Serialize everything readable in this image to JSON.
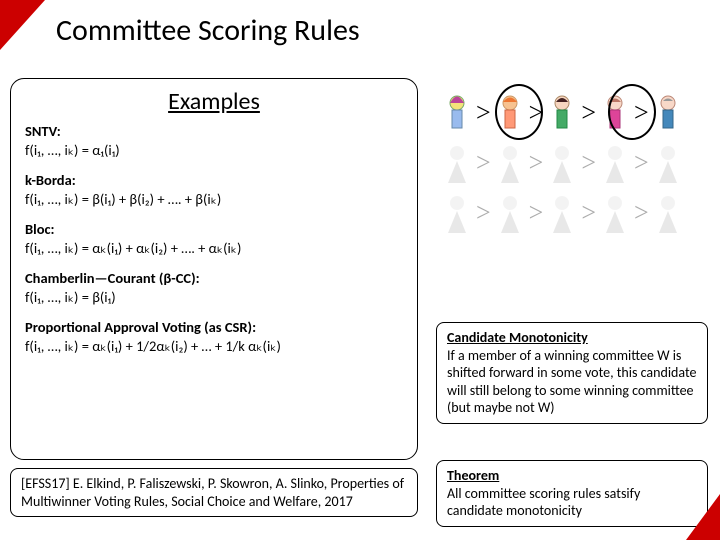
{
  "title": "Committee Scoring Rules",
  "examples": {
    "heading": "Examples",
    "sntv_label": "SNTV:",
    "sntv_formula": "f(i₁, …, iₖ) = α₁(i₁)",
    "kborda_label": "k-Borda:",
    "kborda_formula": "f(i₁, …, iₖ) = β(i₁) + β(i₂) + …. + β(iₖ)",
    "bloc_label": "Bloc:",
    "bloc_formula": "f(i₁, …, iₖ) = αₖ(i₁) + αₖ(i₂) + …. + αₖ(iₖ)",
    "cc_label": "Chamberlin—Courant (β-CC):",
    "cc_formula": "f(i₁, …, iₖ) = β(i₁)",
    "pav_label": "Proportional Approval Voting (as CSR):",
    "pav_formula": "f(i₁, …, iₖ) = αₖ(i₁) + 1/2αₖ(i₂) + … + 1/k αₖ(iₖ)"
  },
  "reference": "[EFSS17] E. Elkind, P. Faliszewski, P. Skowron, A. Slinko, Properties of Multiwinner Voting Rules, Social Choice and Welfare, 2017",
  "monotonicity": {
    "heading": "Candidate Monotonicity",
    "body": "If a member of a winning committee W is shifted forward in some vote, this candidate will still belong to some winning committee (but maybe not W)"
  },
  "theorem": {
    "heading": "Theorem",
    "body": "All committee scoring rules satsify candidate monotonicity"
  },
  "gt": ">"
}
